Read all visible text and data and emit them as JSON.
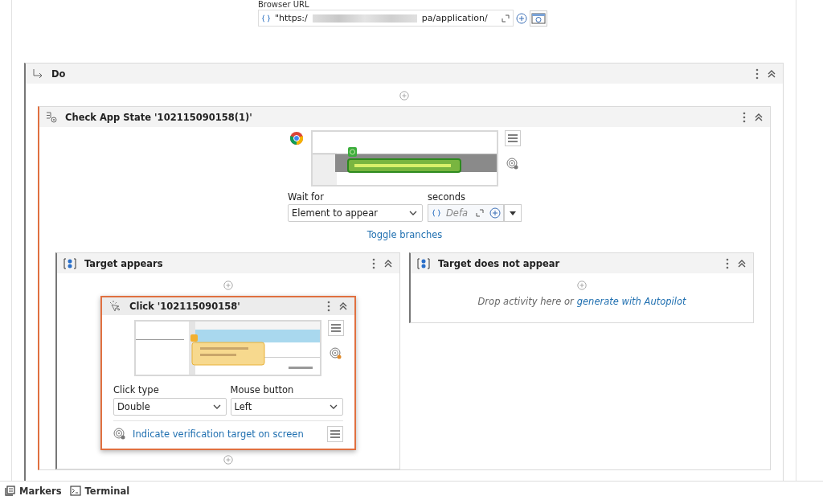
{
  "browser_url": {
    "label": "Browser URL",
    "value_start": "\"https:/",
    "value_end": "pa/application/"
  },
  "do_block": {
    "title": "Do"
  },
  "check_app_state": {
    "title": "Check App State '102115090158(1)'",
    "wait_for": {
      "label": "Wait for",
      "value": "Element to appear"
    },
    "seconds": {
      "label": "seconds",
      "placeholder": "Defa"
    },
    "toggle_link": "Toggle branches"
  },
  "branches": [
    {
      "title": "Target appears",
      "activities": [
        {
          "title": "Click '102115090158'",
          "selected": true,
          "click_type": {
            "label": "Click type",
            "value": "Double"
          },
          "mouse_button": {
            "label": "Mouse button",
            "value": "Left"
          },
          "verification_link": "Indicate verification target on screen"
        }
      ]
    },
    {
      "title": "Target does not appear",
      "drop_text": "Drop activity here or",
      "autopilot_link": "generate with Autopilot"
    }
  ],
  "bottom_tabs": [
    {
      "label": "Markers"
    },
    {
      "label": "Terminal"
    }
  ]
}
